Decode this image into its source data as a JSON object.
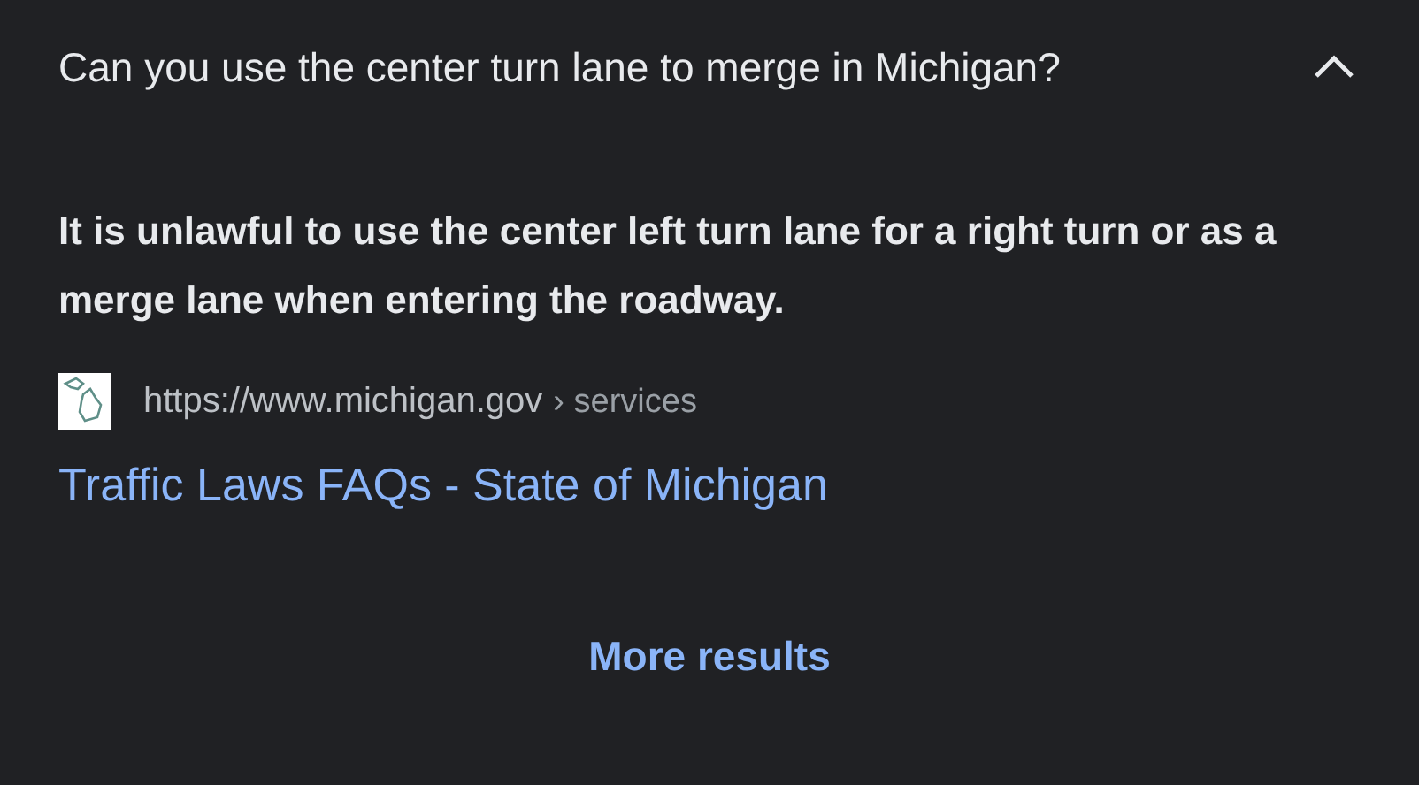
{
  "question": {
    "text": "Can you use the center turn lane to merge in Michigan?",
    "expanded": true
  },
  "answer": "It is unlawful to use the center left turn lane for a right turn or as a merge lane when entering the roadway.",
  "result": {
    "url": "https://www.michigan.gov",
    "breadcrumb": "› services",
    "title": "Traffic Laws FAQs - State of Michigan"
  },
  "more_button": "More results"
}
